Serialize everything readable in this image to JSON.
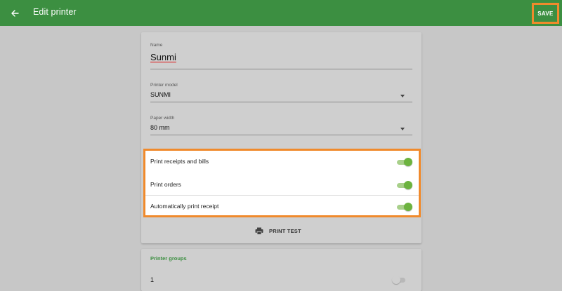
{
  "header": {
    "title": "Edit printer",
    "save_label": "SAVE",
    "back_icon": "arrow-left-icon"
  },
  "form": {
    "name": {
      "label": "Name",
      "value": "Sunmi"
    },
    "printer_model": {
      "label": "Printer model",
      "value": "SUNMI"
    },
    "paper_width": {
      "label": "Paper width",
      "value": "80 mm"
    }
  },
  "toggles": [
    {
      "label": "Print receipts and bills",
      "on": true
    },
    {
      "label": "Print orders",
      "on": true
    },
    {
      "label": "Automatically print receipt",
      "on": true
    }
  ],
  "print_test": {
    "label": "PRINT TEST",
    "icon": "printer-icon"
  },
  "printer_groups": {
    "title": "Printer groups",
    "items": [
      {
        "label": "1",
        "on": false
      }
    ]
  },
  "colors": {
    "app_bar": "#3c8f41",
    "highlight": "#f08a2c",
    "switch_on": "#6cb33f",
    "background": "#c7c7c7"
  }
}
